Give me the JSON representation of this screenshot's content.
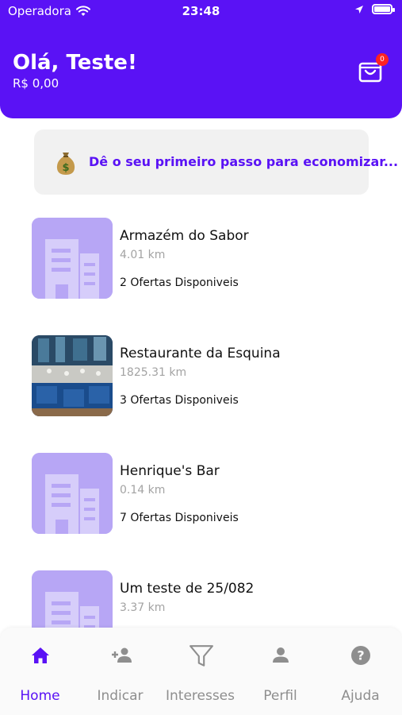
{
  "status_bar": {
    "carrier": "Operadora",
    "time": "23:48"
  },
  "header": {
    "greeting": "Olá, Teste!",
    "balance": "R$ 0,00",
    "cart_count": "0"
  },
  "promo": {
    "text": "Dê o seu primeiro passo para economizar..."
  },
  "stores": [
    {
      "name": "Armazém do Sabor",
      "distance": "4.01 km",
      "offers": "2 Ofertas Disponiveis",
      "image": "building-placeholder"
    },
    {
      "name": "Restaurante da Esquina",
      "distance": "1825.31 km",
      "offers": "3 Ofertas Disponiveis",
      "image": "restaurant-photo"
    },
    {
      "name": "Henrique's Bar",
      "distance": "0.14 km",
      "offers": "7 Ofertas Disponiveis",
      "image": "building-placeholder"
    },
    {
      "name": "Um teste de 25/082",
      "distance": "3.37 km",
      "offers": "",
      "image": "building-placeholder"
    }
  ],
  "tabs": [
    {
      "label": "Home",
      "icon": "home-icon",
      "active": true
    },
    {
      "label": "Indicar",
      "icon": "add-user-icon",
      "active": false
    },
    {
      "label": "Interesses",
      "icon": "filter-icon",
      "active": false
    },
    {
      "label": "Perfil",
      "icon": "person-icon",
      "active": false
    },
    {
      "label": "Ajuda",
      "icon": "help-icon",
      "active": false
    }
  ],
  "colors": {
    "brand": "#5a12f5",
    "placeholder": "#b7a6f5",
    "badge": "#ff2222",
    "inactive_tab": "#8e8e8e"
  }
}
